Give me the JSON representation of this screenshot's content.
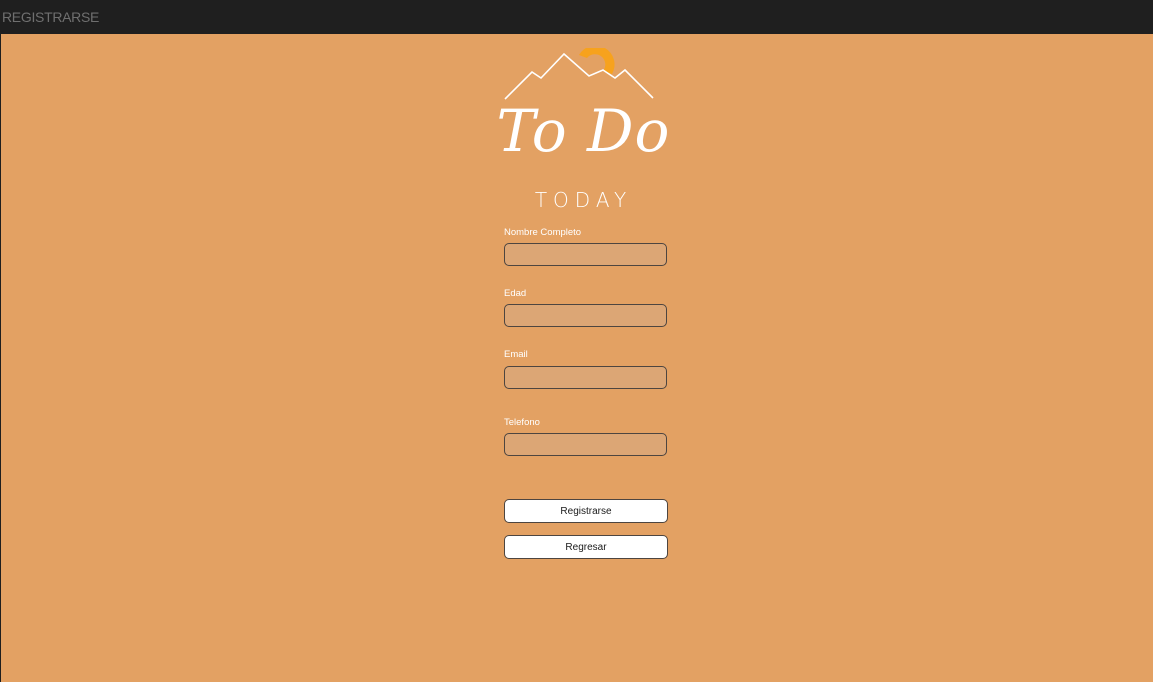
{
  "window": {
    "title": "REGISTRARSE"
  },
  "logo": {
    "main_text": "To Do",
    "sub_text": "TODAY",
    "mountain_icon": "mountain-sun-icon"
  },
  "form": {
    "fields": [
      {
        "label": "Nombre Completo",
        "value": "",
        "placeholder": ""
      },
      {
        "label": "Edad",
        "value": "",
        "placeholder": ""
      },
      {
        "label": "Email",
        "value": "",
        "placeholder": ""
      },
      {
        "label": "Telefono",
        "value": "",
        "placeholder": ""
      }
    ],
    "register_label": "Registrarse",
    "back_label": "Regresar"
  },
  "colors": {
    "background": "#e3a163",
    "titlebar": "#1f1f1f",
    "sun": "#f7a21d",
    "input_fill": "#dca675"
  }
}
